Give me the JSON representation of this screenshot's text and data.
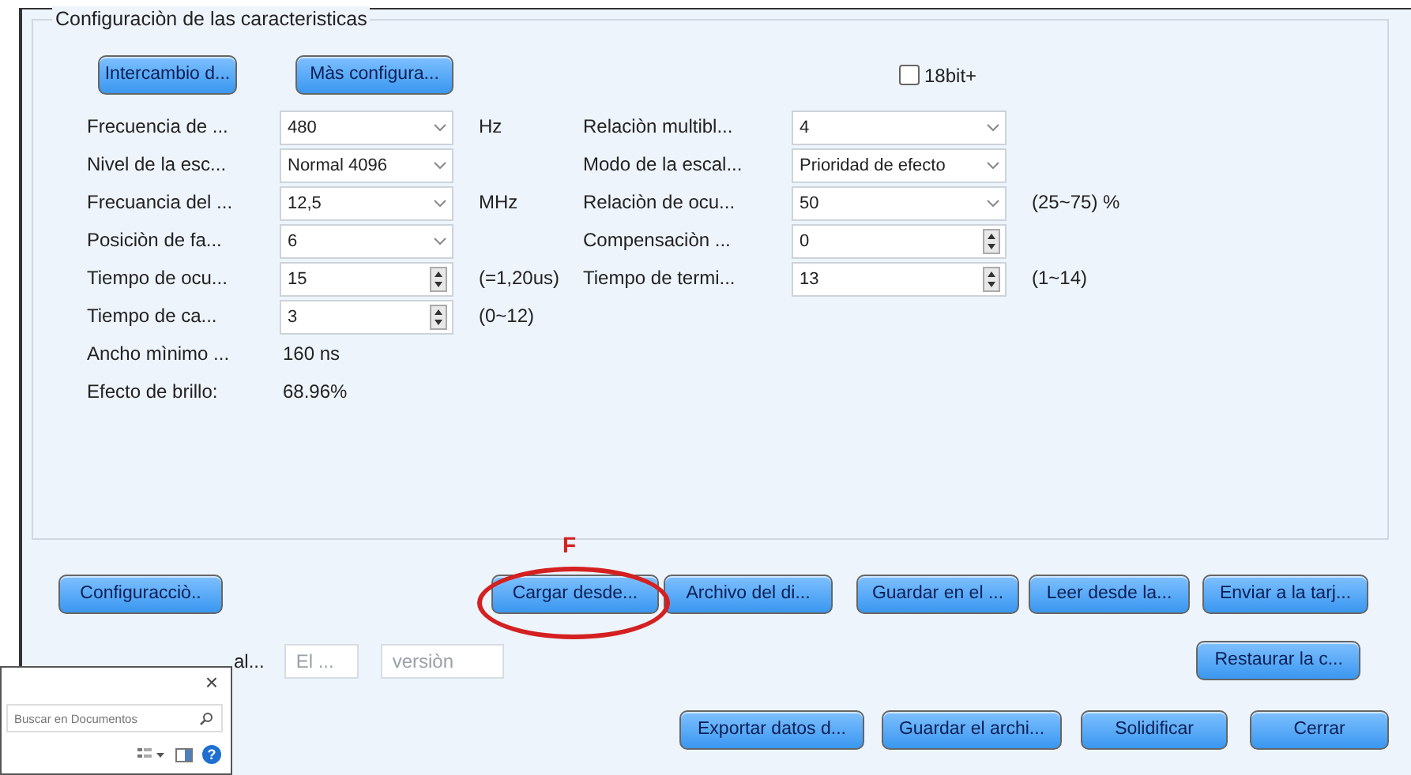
{
  "group": {
    "title": "Configuraciòn de las caracteristicas"
  },
  "top_buttons": [
    "Intercambio d...",
    "Màs configura..."
  ],
  "checkbox": {
    "label": "18bit+",
    "checked": false
  },
  "left_fields": [
    {
      "label": "Frecuencia de ...",
      "kind": "select",
      "value": "480",
      "unit": "Hz"
    },
    {
      "label": "Nivel de la esc...",
      "kind": "select",
      "value": "Normal 4096"
    },
    {
      "label": "Frecuancia del ...",
      "kind": "select",
      "value": "12,5",
      "unit": "MHz"
    },
    {
      "label": "Posiciòn de fa...",
      "kind": "select",
      "value": "6"
    },
    {
      "label": "Tiempo de ocu...",
      "kind": "spin",
      "value": "15",
      "unit": "(=1,20us)"
    },
    {
      "label": "Tiempo de ca...",
      "kind": "spin",
      "value": "3",
      "unit": "(0~12)"
    }
  ],
  "right_fields": [
    {
      "label": "Relaciòn  multibl...",
      "kind": "select",
      "value": "4"
    },
    {
      "label": "Modo de la escal...",
      "kind": "select",
      "value": "Prioridad de efecto"
    },
    {
      "label": "Relaciòn de ocu...",
      "kind": "select",
      "value": "50",
      "unit": "(25~75) %"
    },
    {
      "label": "Compensaciòn ...",
      "kind": "spin",
      "value": "0"
    },
    {
      "label": "Tiempo de termi...",
      "kind": "spin",
      "value": "13",
      "unit": "(1~14)"
    }
  ],
  "readouts": [
    {
      "label": "Ancho mìnimo ...",
      "value": "160 ns"
    },
    {
      "label": "Efecto de brillo:",
      "value": "68.96%"
    }
  ],
  "action_row": {
    "left_button": "Configuracciò..",
    "buttons": [
      "Cargar desde...",
      "Archivo del di...",
      "Guardar en el ...",
      "Leer desde la...",
      "Enviar a la tarj..."
    ]
  },
  "info_row": {
    "label": "al...",
    "fields": [
      {
        "placeholder": "El ..."
      },
      {
        "placeholder": "versiòn"
      }
    ],
    "button": "Restaurar la c..."
  },
  "footer_buttons": [
    "Exportar datos d...",
    "Guardar el archi...",
    "Solidificar",
    "Cerrar"
  ],
  "annotation": {
    "label": "F"
  },
  "overlay_window": {
    "close": "×",
    "search": {
      "placeholder": "Buscar en Documentos"
    },
    "help": "?"
  }
}
